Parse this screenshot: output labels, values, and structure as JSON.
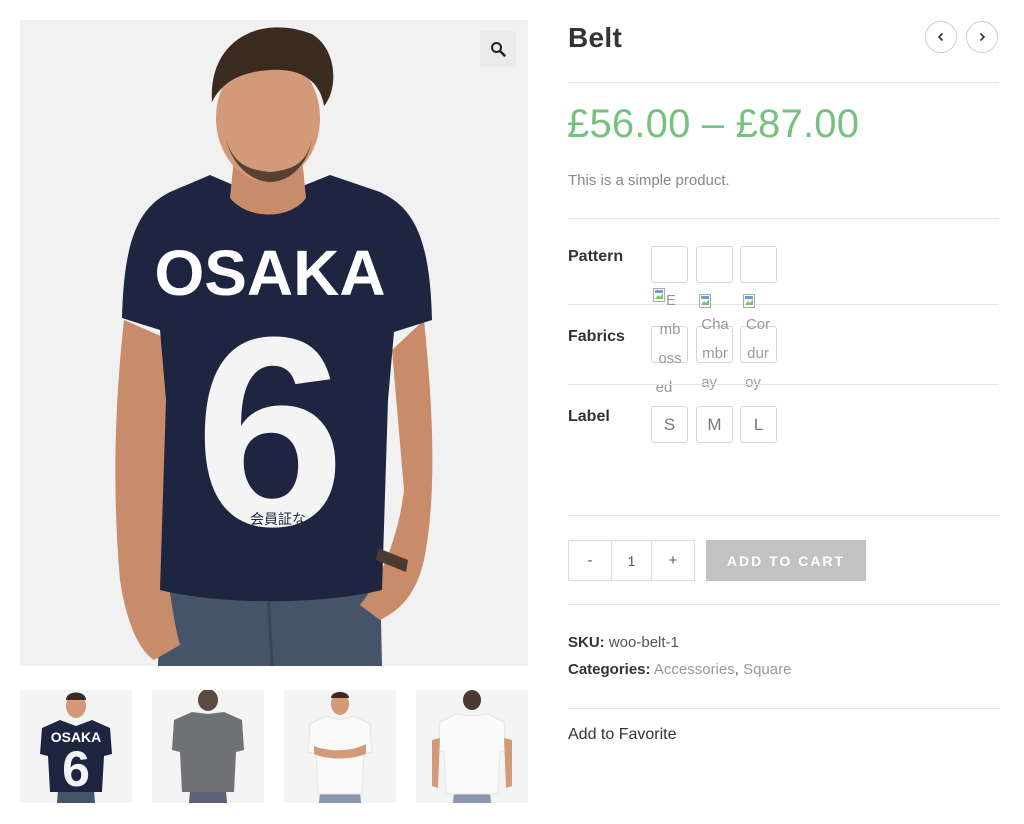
{
  "product": {
    "title": "Belt",
    "price": "£56.00 – £87.00",
    "short_description": "This is a simple product."
  },
  "gallery": {
    "main_image_alt": "Man in navy OSAKA 6 t-shirt",
    "zoom_icon": "search-icon",
    "main_shirt_text": "OSAKA",
    "main_shirt_number": "6",
    "main_shirt_small_text": "会員証な",
    "thumbs": [
      {
        "name": "navy-osaka-front",
        "shirt_color": "#1d2540",
        "shirt_text": "OSAKA",
        "shirt_number": "6"
      },
      {
        "name": "grey-back",
        "shirt_color": "#6f7175"
      },
      {
        "name": "white-front-arms-crossed",
        "shirt_color": "#fafafa"
      },
      {
        "name": "white-back",
        "shirt_color": "#fafafa"
      }
    ]
  },
  "navigation": {
    "prev_icon": "chevron-left-icon",
    "next_icon": "chevron-right-icon"
  },
  "attributes": [
    {
      "label": "Pattern",
      "options": [
        {
          "alt": "Embossed"
        },
        {
          "alt": "Chambray"
        },
        {
          "alt": "Corduroy"
        }
      ]
    },
    {
      "label": "Fabrics",
      "options": []
    },
    {
      "label": "Label",
      "options": [
        {
          "value": "S"
        },
        {
          "value": "M"
        },
        {
          "value": "L"
        }
      ]
    }
  ],
  "swatch_text": {
    "embossed_lines": [
      "E",
      "mb",
      "oss",
      "ed"
    ],
    "chambray_lines": [
      "Cha",
      "mbr",
      "ay"
    ],
    "corduroy_lines": [
      "Cor",
      "dur",
      "oy"
    ]
  },
  "cart": {
    "minus": "-",
    "quantity": "1",
    "plus": "+",
    "add_to_cart": "ADD TO CART"
  },
  "meta": {
    "sku_label": "SKU:",
    "sku_value": "woo-belt-1",
    "categories_label": "Categories:",
    "categories": [
      "Accessories",
      "Square"
    ],
    "separator": ","
  },
  "favorite": "Add to Favorite",
  "colors": {
    "price": "#77c17f",
    "cart_button": "#c2c2c2",
    "shirt_navy": "#1d2540"
  }
}
